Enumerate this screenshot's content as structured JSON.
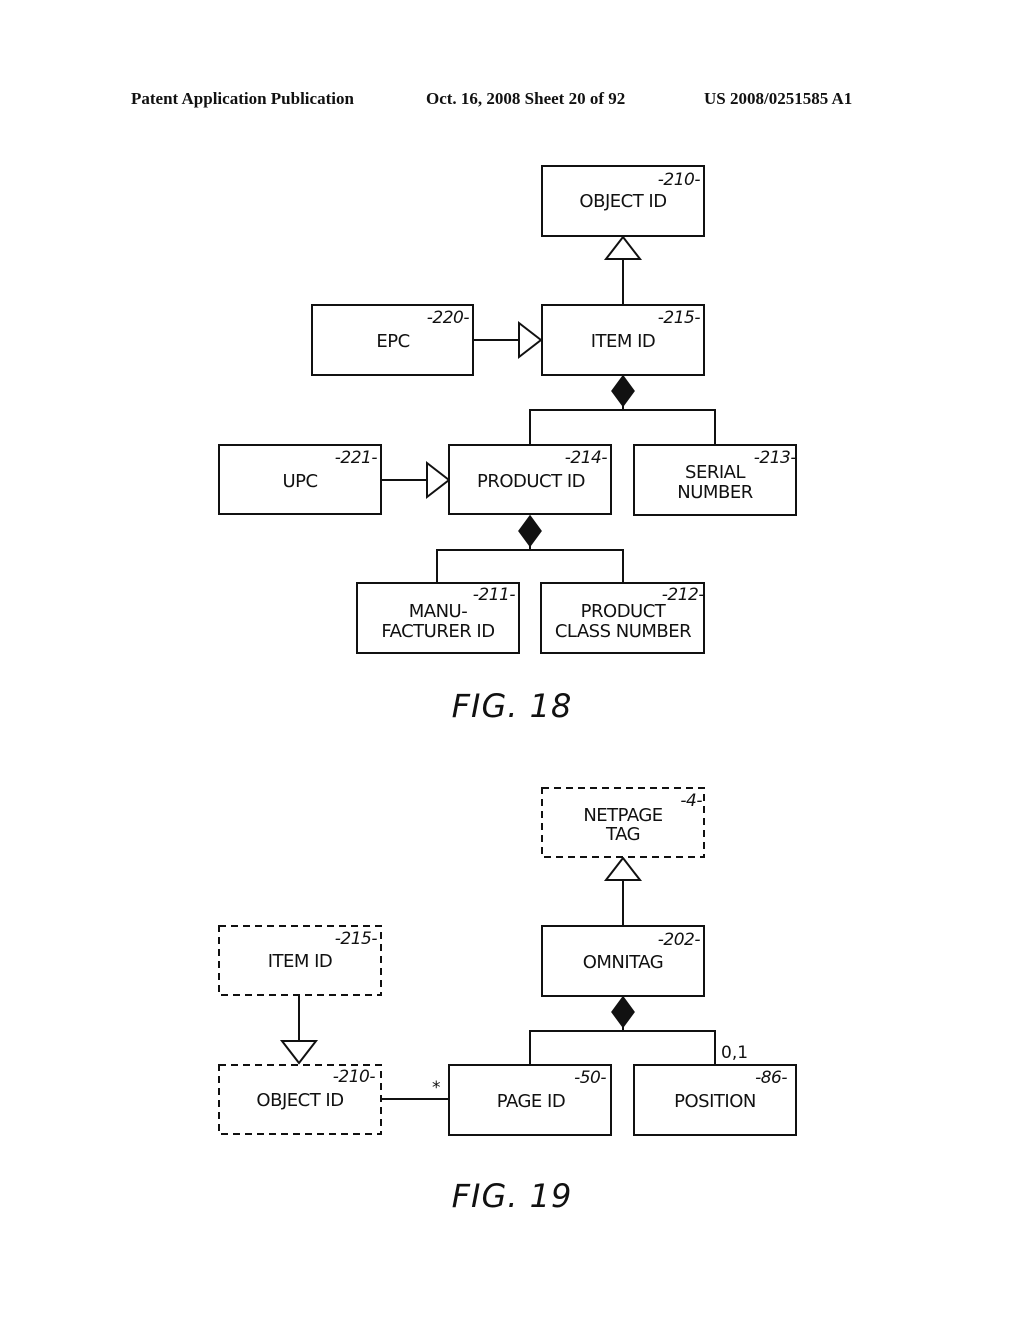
{
  "header": {
    "publication": "Patent Application Publication",
    "date_sheet": "Oct. 16, 2008  Sheet 20 of 92",
    "patent_number": "US 2008/0251585 A1"
  },
  "fig18": {
    "caption": "FIG. 18",
    "boxes": {
      "object_id": {
        "ref": "-210-",
        "lines": [
          "OBJECT ID"
        ]
      },
      "epc": {
        "ref": "-220-",
        "lines": [
          "EPC"
        ]
      },
      "item_id": {
        "ref": "-215-",
        "lines": [
          "ITEM ID"
        ]
      },
      "upc": {
        "ref": "-221-",
        "lines": [
          "UPC"
        ]
      },
      "product_id": {
        "ref": "-214-",
        "lines": [
          "PRODUCT ID"
        ]
      },
      "serial_number": {
        "ref": "-213-",
        "lines": [
          "SERIAL",
          "NUMBER"
        ]
      },
      "manufacturer_id": {
        "ref": "-211-",
        "lines": [
          "MANU-",
          "FACTURER ID"
        ]
      },
      "product_class_number": {
        "ref": "-212-",
        "lines": [
          "PRODUCT",
          "CLASS NUMBER"
        ]
      }
    },
    "relations": [
      {
        "type": "generalization",
        "from": "item_id",
        "to": "object_id"
      },
      {
        "type": "generalization",
        "from": "epc",
        "to": "item_id"
      },
      {
        "type": "composition",
        "whole": "item_id",
        "parts": [
          "product_id",
          "serial_number"
        ]
      },
      {
        "type": "generalization",
        "from": "upc",
        "to": "product_id"
      },
      {
        "type": "composition",
        "whole": "product_id",
        "parts": [
          "manufacturer_id",
          "product_class_number"
        ]
      }
    ]
  },
  "fig19": {
    "caption": "FIG. 19",
    "boxes": {
      "netpage_tag": {
        "ref": "-4-",
        "lines": [
          "NETPAGE",
          "TAG"
        ],
        "dashed": true
      },
      "omnitag": {
        "ref": "-202-",
        "lines": [
          "OMNITAG"
        ]
      },
      "item_id": {
        "ref": "-215-",
        "lines": [
          "ITEM ID"
        ],
        "dashed": true
      },
      "object_id": {
        "ref": "-210-",
        "lines": [
          "OBJECT ID"
        ],
        "dashed": true
      },
      "page_id": {
        "ref": "-50-",
        "lines": [
          "PAGE ID"
        ]
      },
      "position": {
        "ref": "-86-",
        "lines": [
          "POSITION"
        ]
      }
    },
    "multiplicities": {
      "object_to_page": "*",
      "position": "0,1"
    },
    "relations": [
      {
        "type": "generalization",
        "from": "omnitag",
        "to": "netpage_tag"
      },
      {
        "type": "generalization",
        "from": "item_id",
        "to": "object_id"
      },
      {
        "type": "composition",
        "whole": "omnitag",
        "parts": [
          "page_id",
          "position"
        ]
      },
      {
        "type": "association",
        "from": "object_id",
        "to": "page_id"
      }
    ]
  }
}
